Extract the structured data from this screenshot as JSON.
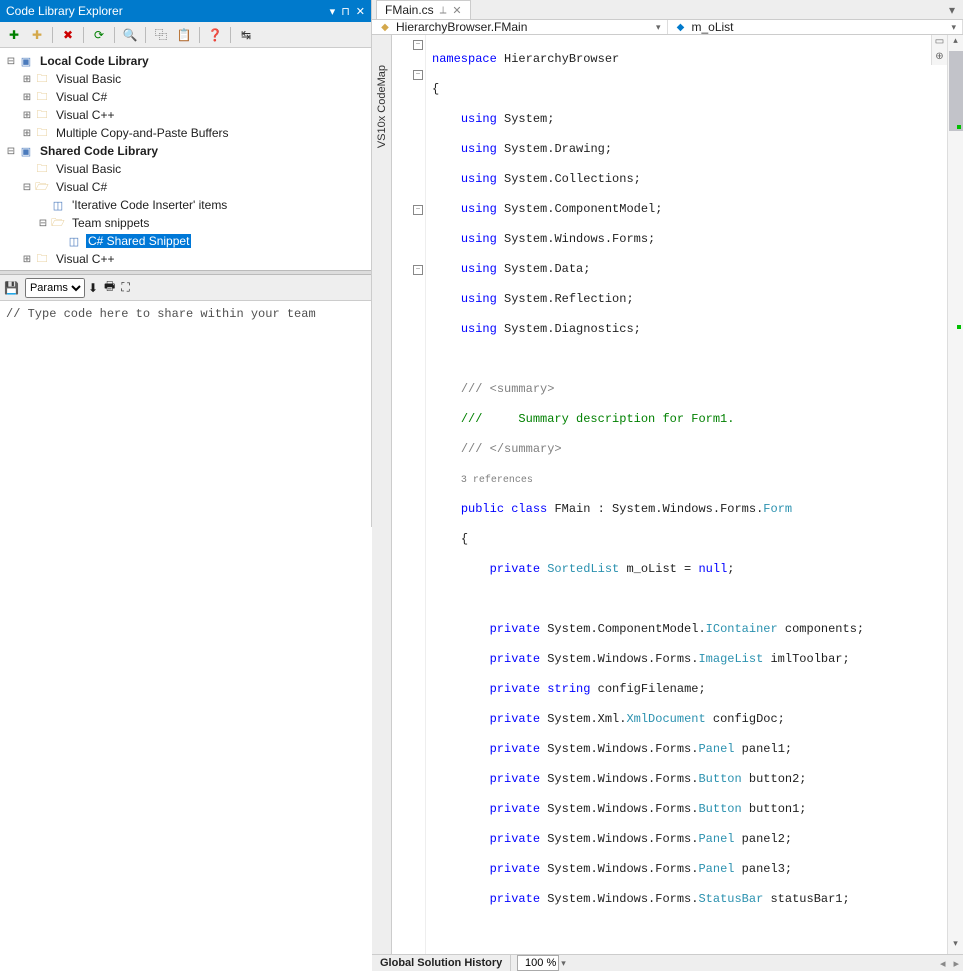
{
  "panel": {
    "title": "Code Library Explorer",
    "toolbar_icons": [
      "add-item",
      "add-folder",
      "delete",
      "refresh",
      "search",
      "copy",
      "paste",
      "props",
      "help",
      "collapse"
    ]
  },
  "tree": {
    "root1": {
      "label": "Local Code Library"
    },
    "root1_children": [
      {
        "label": "Visual Basic"
      },
      {
        "label": "Visual C#"
      },
      {
        "label": "Visual C++"
      },
      {
        "label": "Multiple Copy-and-Paste Buffers"
      }
    ],
    "root2": {
      "label": "Shared Code Library"
    },
    "r2_vb": {
      "label": "Visual Basic"
    },
    "r2_cs": {
      "label": "Visual C#"
    },
    "r2_cs_items": {
      "label": "'Iterative Code Inserter' items"
    },
    "r2_cs_team": {
      "label": "Team snippets"
    },
    "r2_cs_team_snip": {
      "label": "C# Shared Snippet"
    },
    "r2_cpp": {
      "label": "Visual C++"
    }
  },
  "bottom": {
    "dropdown": "Params",
    "placeholder": "// Type code here to share within your team"
  },
  "editor": {
    "tab": "FMain.cs",
    "nav_left": "HierarchyBrowser.FMain",
    "nav_right": "m_oList",
    "codemap": "VS10x CodeMap",
    "zoom": "100 %",
    "status": "Global Solution History"
  },
  "code": {
    "l1": "namespace",
    "l1b": " HierarchyBrowser",
    "l2": "{",
    "u": "using",
    "u1": " System;",
    "u2": " System.Drawing;",
    "u3": " System.Collections;",
    "u4": " System.ComponentModel;",
    "u5": " System.Windows.Forms;",
    "u6": " System.Data;",
    "u7": " System.Reflection;",
    "u8": " System.Diagnostics;",
    "c1": "/// ",
    "c1t": "<summary>",
    "c2": "///     Summary description for Form1.",
    "c3": "/// ",
    "c3t": "</summary>",
    "refs": "3 references",
    "pub": "public",
    "cls": " class",
    "fmain": " FMain : System.Windows.Forms.",
    "form": "Form",
    "ob": "{",
    "priv": "private",
    "p1a": "SortedList",
    "p1b": " m_oList = ",
    "p1c": "null",
    "p1d": ";",
    "p2a": " System.ComponentModel.",
    "p2b": "IContainer",
    "p2c": " components;",
    "p3a": " System.Windows.Forms.",
    "p3b": "ImageList",
    "p3c": " imlToolbar;",
    "p4a": "string",
    "p4b": " configFilename;",
    "p5a": " System.Xml.",
    "p5b": "XmlDocument",
    "p5c": " configDoc;",
    "p6b": "Panel",
    "p6c": " panel1;",
    "p7b": "Button",
    "p7c": " button2;",
    "p8c": " button1;",
    "p9c": " panel2;",
    "p10c": " panel3;",
    "p11b": "StatusBar",
    "p11c": " statusBar1;"
  }
}
